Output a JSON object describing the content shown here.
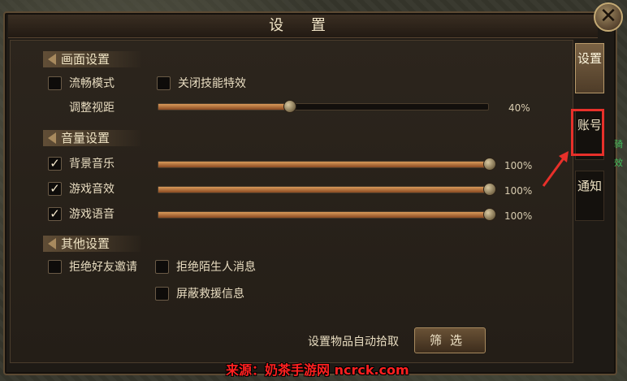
{
  "window": {
    "title": "设 置",
    "close_icon": "close-icon"
  },
  "tabs": [
    {
      "label": "设置",
      "active": true
    },
    {
      "label": "账号",
      "active": false,
      "highlighted": true
    },
    {
      "label": "通知",
      "active": false
    }
  ],
  "display": {
    "header": "画面设置",
    "smooth_mode": {
      "label": "流畅模式",
      "checked": false
    },
    "disable_skill_effects": {
      "label": "关闭技能特效",
      "checked": false
    },
    "view_distance": {
      "label": "调整视距",
      "value_text": "40%",
      "value": 0.4
    }
  },
  "volume": {
    "header": "音量设置",
    "rows": [
      {
        "label": "背景音乐",
        "checked": true,
        "value_text": "100%",
        "value": 1.0
      },
      {
        "label": "游戏音效",
        "checked": true,
        "value_text": "100%",
        "value": 1.0
      },
      {
        "label": "游戏语音",
        "checked": true,
        "value_text": "100%",
        "value": 1.0
      }
    ]
  },
  "other": {
    "header": "其他设置",
    "reject_friend_invite": {
      "label": "拒绝好友邀请",
      "checked": false
    },
    "reject_stranger_msg": {
      "label": "拒绝陌生人消息",
      "checked": false
    },
    "block_rescue_info": {
      "label": "屏蔽救援信息",
      "checked": false
    }
  },
  "auto_pickup": {
    "label": "设置物品自动拾取",
    "button": "筛选"
  },
  "watermark": "来源：奶茶手游网 ncrck.com",
  "side_glimpse": [
    "骑",
    "效"
  ],
  "colors": {
    "highlight": "#e8302a",
    "watermark": "#ff2020"
  }
}
